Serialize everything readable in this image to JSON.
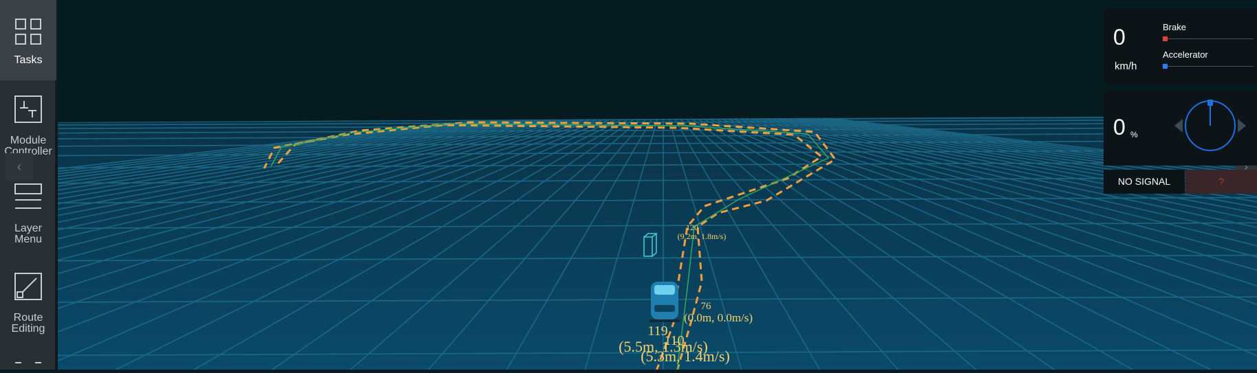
{
  "sidebar": {
    "items": [
      {
        "label": "Tasks",
        "icon": "tasks-grid-icon",
        "active": true
      },
      {
        "label": "Module Controller",
        "icon": "module-controller-icon",
        "active": false
      },
      {
        "label": "Layer Menu",
        "icon": "layer-menu-icon",
        "active": false
      },
      {
        "label": "Route Editing",
        "icon": "route-editing-icon",
        "active": false
      },
      {
        "label": "",
        "icon": "more-icon",
        "active": false
      }
    ]
  },
  "scene": {
    "obstacle_labels": [
      {
        "id": "120",
        "info": "(9.2m, 1.8m/s)"
      },
      {
        "id": "76",
        "info": "(0.0m, 0.0m/s)"
      },
      {
        "id": "119",
        "info": "(5.5m, 1.3m/s)"
      },
      {
        "id": "110",
        "info": "(5.3m, 1.4m/s)"
      }
    ],
    "colors": {
      "path": "#f0a040",
      "grid": "#1f6f8f",
      "sky": "#07191e",
      "ground": "#0a3a52",
      "label": "#f5d46a"
    }
  },
  "dashboard": {
    "speed": {
      "value": "0",
      "unit": "km/h"
    },
    "brake": {
      "label": "Brake",
      "level": 0,
      "color": "#e04040"
    },
    "accelerator": {
      "label": "Accelerator",
      "level": 0,
      "color": "#2a7fff"
    },
    "steering": {
      "value": "0",
      "unit": "%"
    },
    "signal": {
      "status": "NO SIGNAL",
      "light": "?"
    }
  }
}
